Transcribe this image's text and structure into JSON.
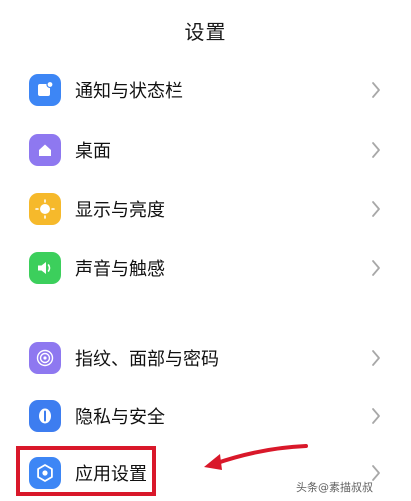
{
  "header": {
    "title": "设置"
  },
  "menu": {
    "items": [
      {
        "label": "通知与状态栏",
        "icon": "notification-icon",
        "color": "#3d86f5"
      },
      {
        "label": "桌面",
        "icon": "home-icon",
        "color": "#8e78f0"
      },
      {
        "label": "显示与亮度",
        "icon": "sun-icon",
        "color": "#f6b92b"
      },
      {
        "label": "声音与触感",
        "icon": "speaker-icon",
        "color": "#3ccf5c"
      },
      {
        "label": "指纹、面部与密码",
        "icon": "fingerprint-icon",
        "color": "#8e78f0"
      },
      {
        "label": "隐私与安全",
        "icon": "shield-icon",
        "color": "#3d7df0"
      },
      {
        "label": "应用设置",
        "icon": "app-settings-icon",
        "color": "#3d86f5"
      }
    ]
  },
  "annotation": {
    "highlight_color": "#d9182a",
    "arrow_color": "#d9182a"
  },
  "watermark": {
    "text": "头条@素描叔叔"
  }
}
